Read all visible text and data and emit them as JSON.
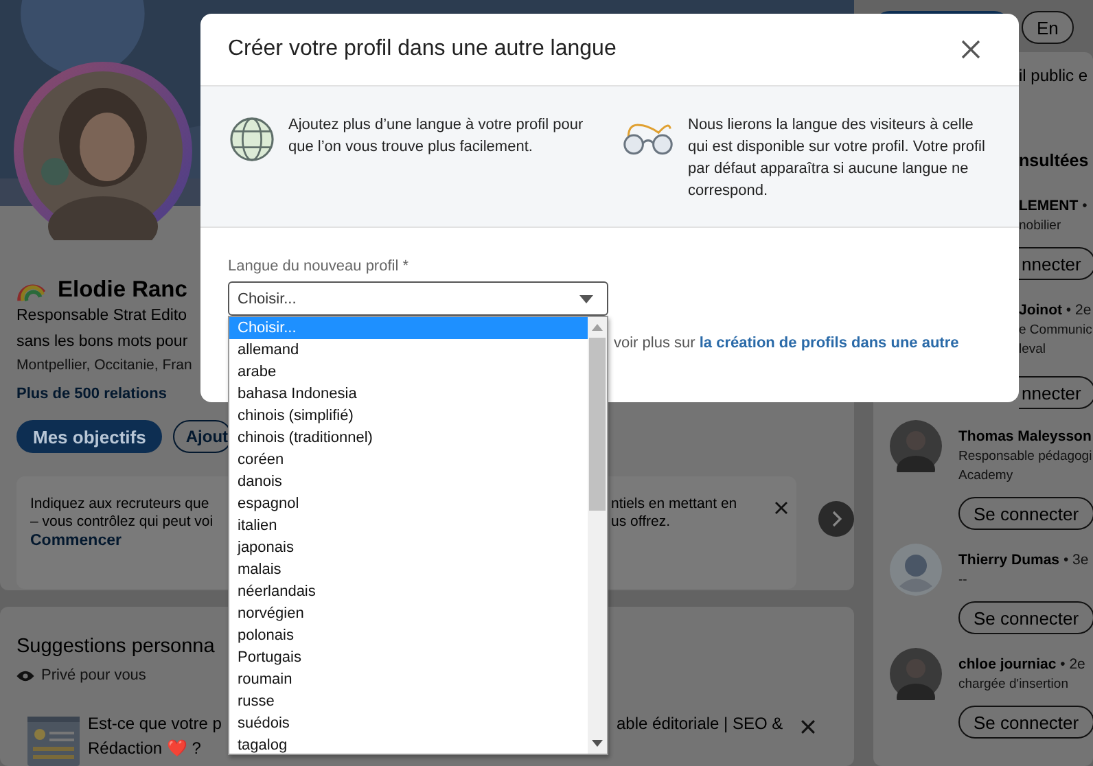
{
  "profile": {
    "name": "Elodie Ranc",
    "headline": [
      "Responsable Strat Edito",
      "sans les bons mots pour"
    ],
    "location": "Montpellier, Occitanie, Fran",
    "connections": "Plus de 500 relations",
    "buttons": [
      {
        "label": "Mes objectifs",
        "kind": "primary"
      },
      {
        "label": "Ajout",
        "kind": "outline"
      }
    ]
  },
  "recruiter_card": {
    "left_lines": [
      "Indiquez aux recruteurs que",
      "– vous contrôlez qui peut voi"
    ],
    "right_lines": [
      "ntiels en mettant en",
      "us offrez."
    ],
    "link": "Commencer"
  },
  "suggestions": {
    "title": "Suggestions personna",
    "privacy": "Privé pour vous",
    "item_left": [
      "Est-ce que votre p",
      "Rédaction ❤️ ?"
    ],
    "item_right": "able éditoriale | SEO &"
  },
  "right_rail": {
    "top_button": "En",
    "fragment": "il public e",
    "heading": "nsultées",
    "cut_people": [
      {
        "name": "LEMENT",
        "degree": "•",
        "lines": [
          "nobilier"
        ],
        "button": "nnecter"
      },
      {
        "name": "Joinot",
        "degree": "• 2e",
        "lines": [
          "e Communic",
          "leval"
        ],
        "button": "nnecter"
      }
    ],
    "people": [
      {
        "name": "Thomas Maleysson",
        "lines": [
          "Responsable pédagogi",
          "Academy"
        ],
        "button": "Se connecter"
      },
      {
        "name": "Thierry Dumas",
        "degree": "• 3e",
        "lines": [
          "--"
        ],
        "button": "Se connecter",
        "kind": "placeholder"
      },
      {
        "name": "chloe journiac",
        "degree": "• 2e",
        "lines": [
          "chargée d'insertion"
        ],
        "button": "Se connecter"
      }
    ]
  },
  "modal": {
    "title": "Créer votre profil dans une autre langue",
    "info": [
      "Ajoutez plus d’une langue à votre profil pour que l’on vous trouve plus facilement.",
      "Nous lierons la langue des visiteurs à celle qui est disponible sur votre profil. Votre profil par défaut apparaîtra si aucune langue ne correspond."
    ],
    "field_label": "Langue du nouveau profil *",
    "select_value": "Choisir...",
    "help_prefix": "voir plus sur",
    "help_link": "la création de profils dans une autre",
    "options": [
      {
        "label": "Choisir...",
        "selected": true
      },
      {
        "label": "allemand",
        "selected": false
      },
      {
        "label": "arabe",
        "selected": false
      },
      {
        "label": "bahasa Indonesia",
        "selected": false
      },
      {
        "label": "chinois (simplifié)",
        "selected": false
      },
      {
        "label": "chinois (traditionnel)",
        "selected": false
      },
      {
        "label": "coréen",
        "selected": false
      },
      {
        "label": "danois",
        "selected": false
      },
      {
        "label": "espagnol",
        "selected": false
      },
      {
        "label": "italien",
        "selected": false
      },
      {
        "label": "japonais",
        "selected": false
      },
      {
        "label": "malais",
        "selected": false
      },
      {
        "label": "néerlandais",
        "selected": false
      },
      {
        "label": "norvégien",
        "selected": false
      },
      {
        "label": "polonais",
        "selected": false
      },
      {
        "label": "Portugais",
        "selected": false
      },
      {
        "label": "roumain",
        "selected": false
      },
      {
        "label": "russe",
        "selected": false
      },
      {
        "label": "suédois",
        "selected": false
      },
      {
        "label": "tagalog",
        "selected": false
      }
    ]
  }
}
